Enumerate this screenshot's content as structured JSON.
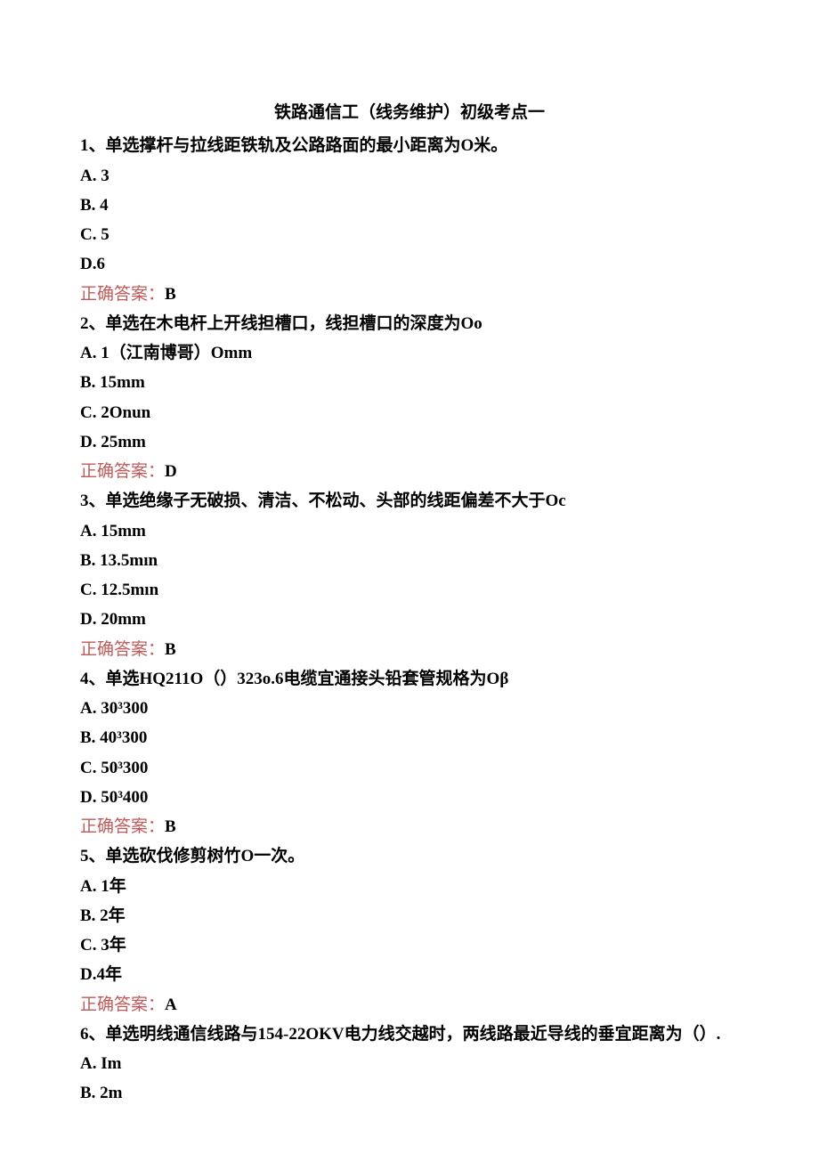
{
  "title": "铁路通信工（线务维护）初级考点一",
  "answer_label": "正确答案：",
  "questions": [
    {
      "num": "1",
      "stem": "、单选撑杆与拉线距铁轨及公路路面的最小距离为O米。",
      "options": [
        "A.  3",
        "B.  4",
        "C.  5",
        "D.6"
      ],
      "answer": "B"
    },
    {
      "num": "2",
      "stem": "、单选在木电杆上开线担槽口，线担槽口的深度为Oo",
      "options": [
        "A.  1（江南博哥）Omm",
        "B.  15mm",
        "C.  2Onun",
        "D.  25mm"
      ],
      "answer": "D"
    },
    {
      "num": "3",
      "stem": "、单选绝缘子无破损、清洁、不松动、头部的线距偏差不大于Oc",
      "options": [
        "A.  15mm",
        "B.  13.5mın",
        "C.  12.5mın",
        "D.  20mm"
      ],
      "answer": "B"
    },
    {
      "num": "4",
      "stem": "、单选HQ211O（）323o.6电缆宜通接头铅套管规格为Oβ",
      "options": [
        "A.  30³300",
        "B.  40³300",
        "C.  50³300",
        "D.  50³400"
      ],
      "answer": "B"
    },
    {
      "num": "5",
      "stem": "、单选砍伐修剪树竹O一次。",
      "options": [
        "A.  1年",
        "B.  2年",
        "C.  3年",
        "D.4年"
      ],
      "answer": "A"
    },
    {
      "num": "6",
      "stem": "、单选明线通信线路与154-22OKV电力线交越时，两线路最近导线的垂宜距离为（）.",
      "options": [
        "A.  Im",
        "B.  2m"
      ],
      "answer": null
    }
  ]
}
